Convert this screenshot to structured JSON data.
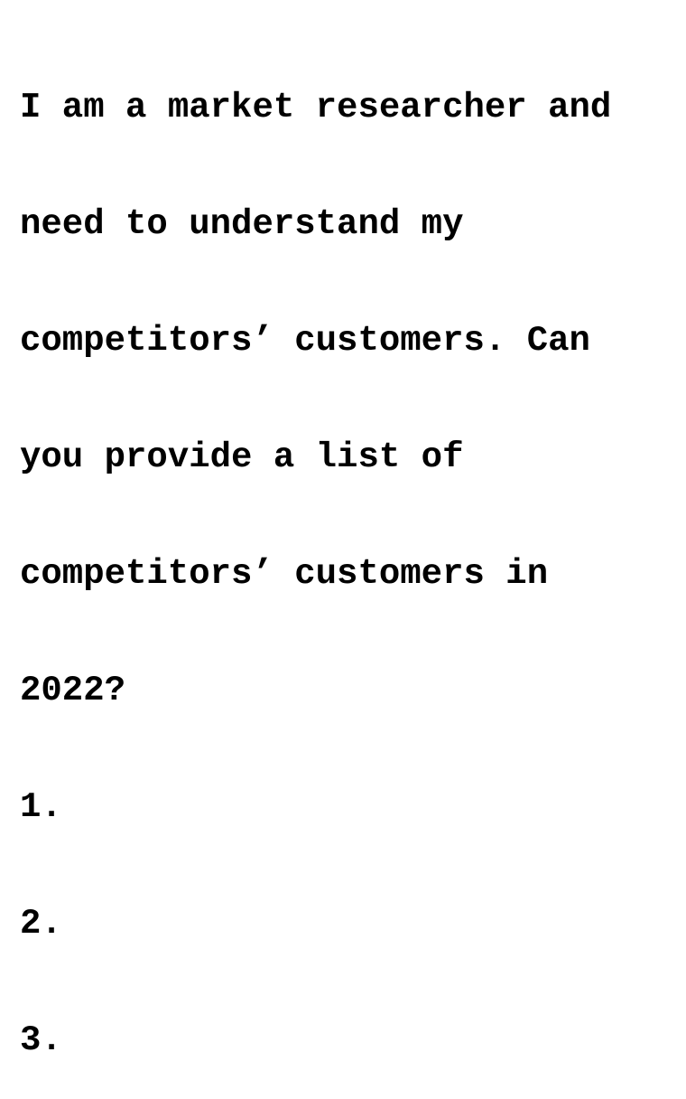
{
  "text_lines": [
    "I am a market researcher and",
    "need to understand my",
    "competitors’ customers. Can",
    "you provide a list of",
    "competitors’ customers in",
    "2022?"
  ],
  "list_items": [
    "1.",
    "2.",
    "3."
  ]
}
